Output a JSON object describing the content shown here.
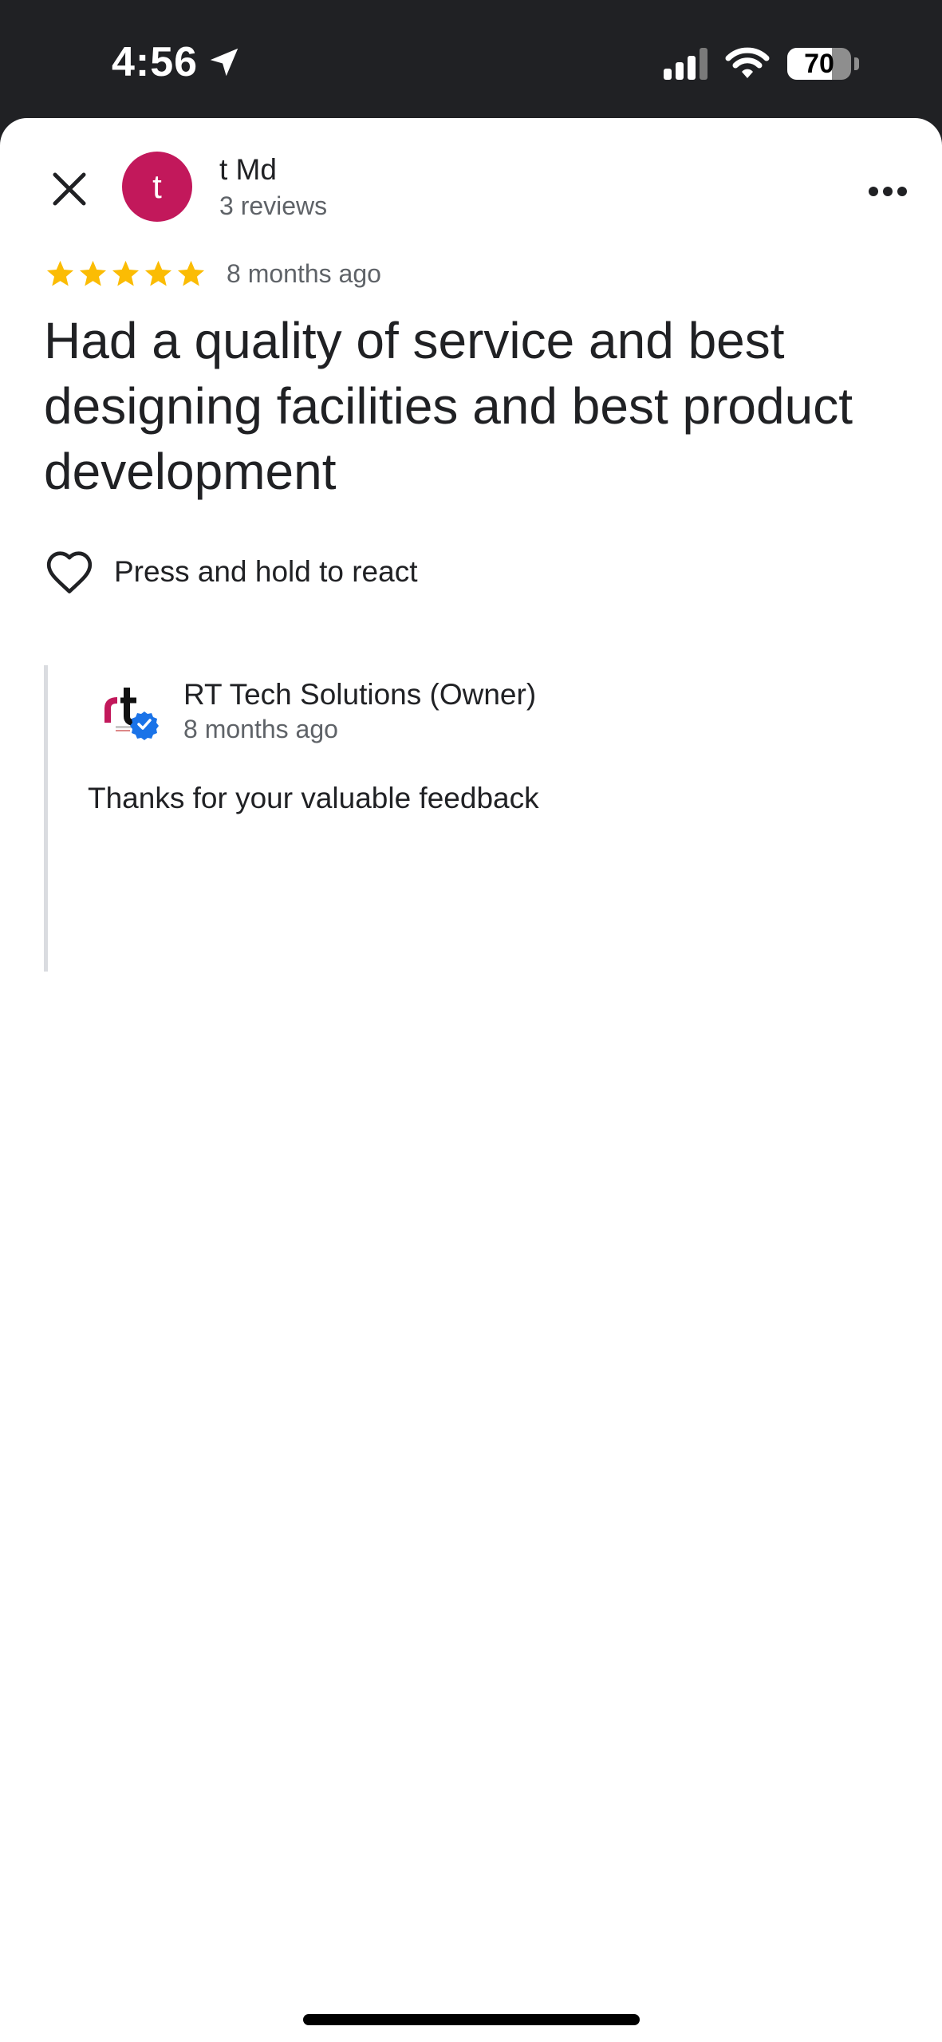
{
  "status_bar": {
    "time": "4:56",
    "battery": "70",
    "battery_level": 0.7,
    "icons": [
      "location-arrow-icon",
      "cellular-signal-icon",
      "wifi-icon",
      "battery-icon"
    ]
  },
  "header": {
    "close_icon": "close-icon",
    "avatar_initial": "t",
    "avatar_color": "#C2185B",
    "reviewer_name": "t Md",
    "reviewer_reviews": "3 reviews",
    "more_icon": "more-horizontal-icon"
  },
  "review": {
    "rating": 5,
    "rating_max": 5,
    "star_color": "#FBBC04",
    "time": "8 months ago",
    "text": "Had a quality of service and best designing facilities and best product development"
  },
  "react": {
    "icon": "heart-outline-icon",
    "label": "Press and hold to react"
  },
  "owner_reply": {
    "name": "RT Tech Solutions (Owner)",
    "time": "8 months ago",
    "text": "Thanks for your valuable feedback",
    "verified_color": "#1A73E8"
  }
}
